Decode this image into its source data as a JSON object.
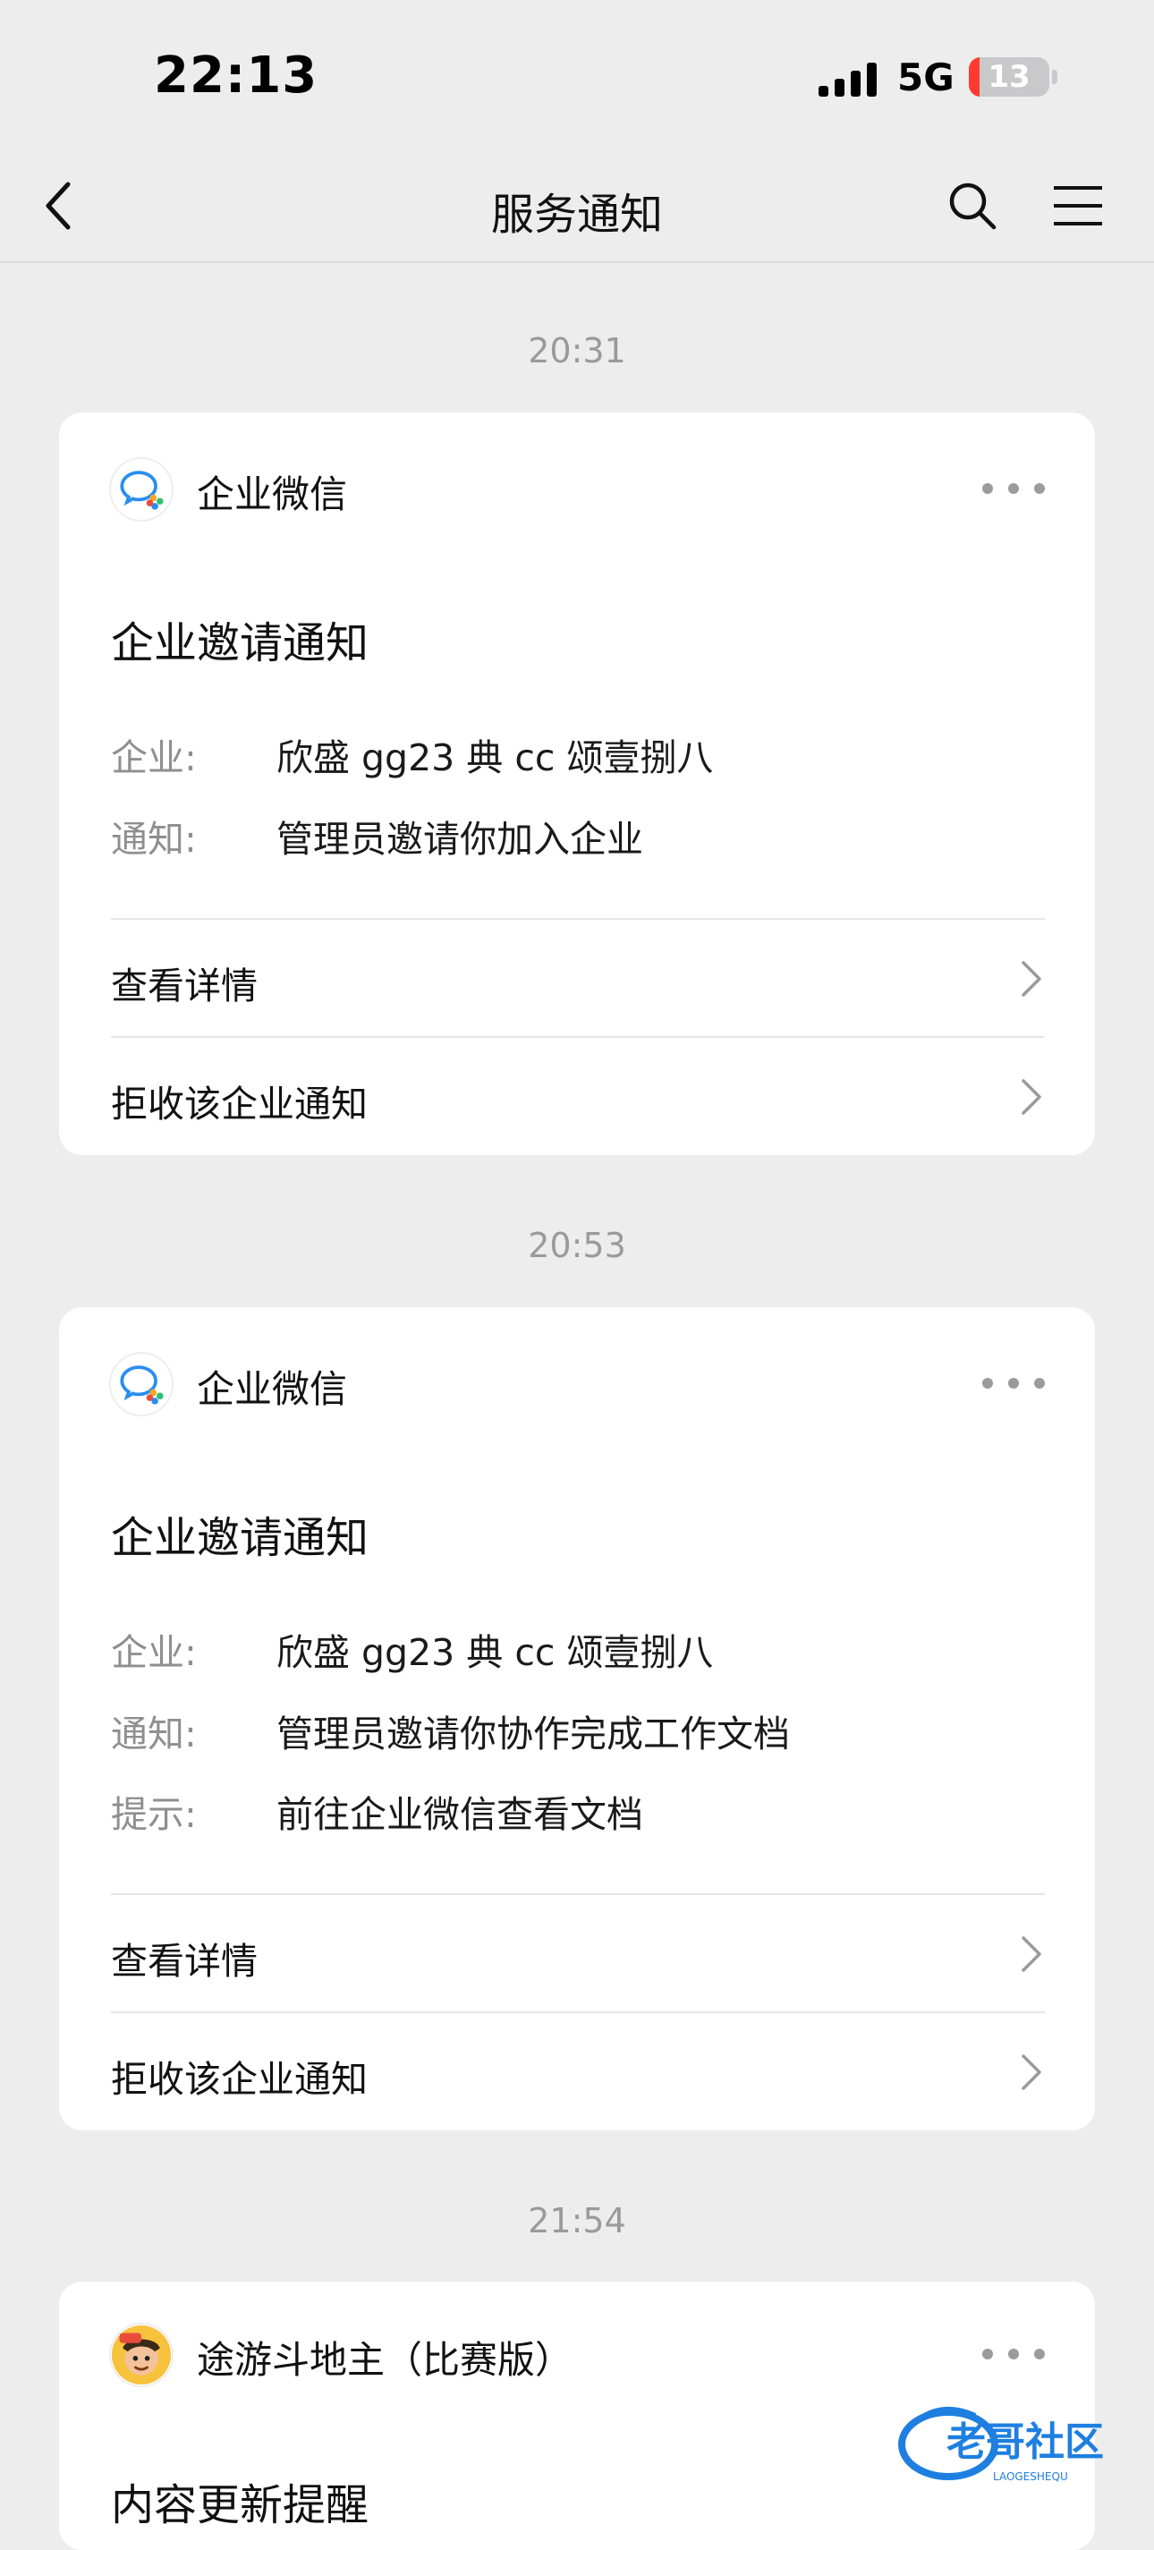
{
  "status_bar": {
    "time": "22:13",
    "network": "5G",
    "battery": "13",
    "battery_level_percent": 13
  },
  "nav": {
    "title": "服务通知"
  },
  "messages": [
    {
      "timestamp": "20:31",
      "app_name": "企业微信",
      "title": "企业邀请通知",
      "fields": [
        {
          "key": "企业:",
          "value": "欣盛 gg23 典 cc 颂壹捌八"
        },
        {
          "key": "通知:",
          "value": "管理员邀请你加入企业"
        }
      ],
      "actions": [
        {
          "label": "查看详情"
        },
        {
          "label": "拒收该企业通知"
        }
      ]
    },
    {
      "timestamp": "20:53",
      "app_name": "企业微信",
      "title": "企业邀请通知",
      "fields": [
        {
          "key": "企业:",
          "value": "欣盛 gg23 典 cc 颂壹捌八"
        },
        {
          "key": "通知:",
          "value": "管理员邀请你协作完成工作文档"
        },
        {
          "key": "提示:",
          "value": "前往企业微信查看文档"
        }
      ],
      "actions": [
        {
          "label": "查看详情"
        },
        {
          "label": "拒收该企业通知"
        }
      ]
    },
    {
      "timestamp": "21:54",
      "app_name": "途游斗地主（比赛版）",
      "title": "内容更新提醒"
    }
  ],
  "watermark": {
    "text": "老哥社区",
    "subtext": "LAOGESHEQU"
  },
  "icons": {
    "back": "chevron-left-icon",
    "search": "search-icon",
    "menu": "hamburger-menu-icon",
    "more": "more-dots-icon",
    "chevron": "chevron-right-icon"
  },
  "colors": {
    "background": "#ededed",
    "card": "#ffffff",
    "muted_text": "#8f8f8f",
    "battery_low": "#ff3b30"
  }
}
